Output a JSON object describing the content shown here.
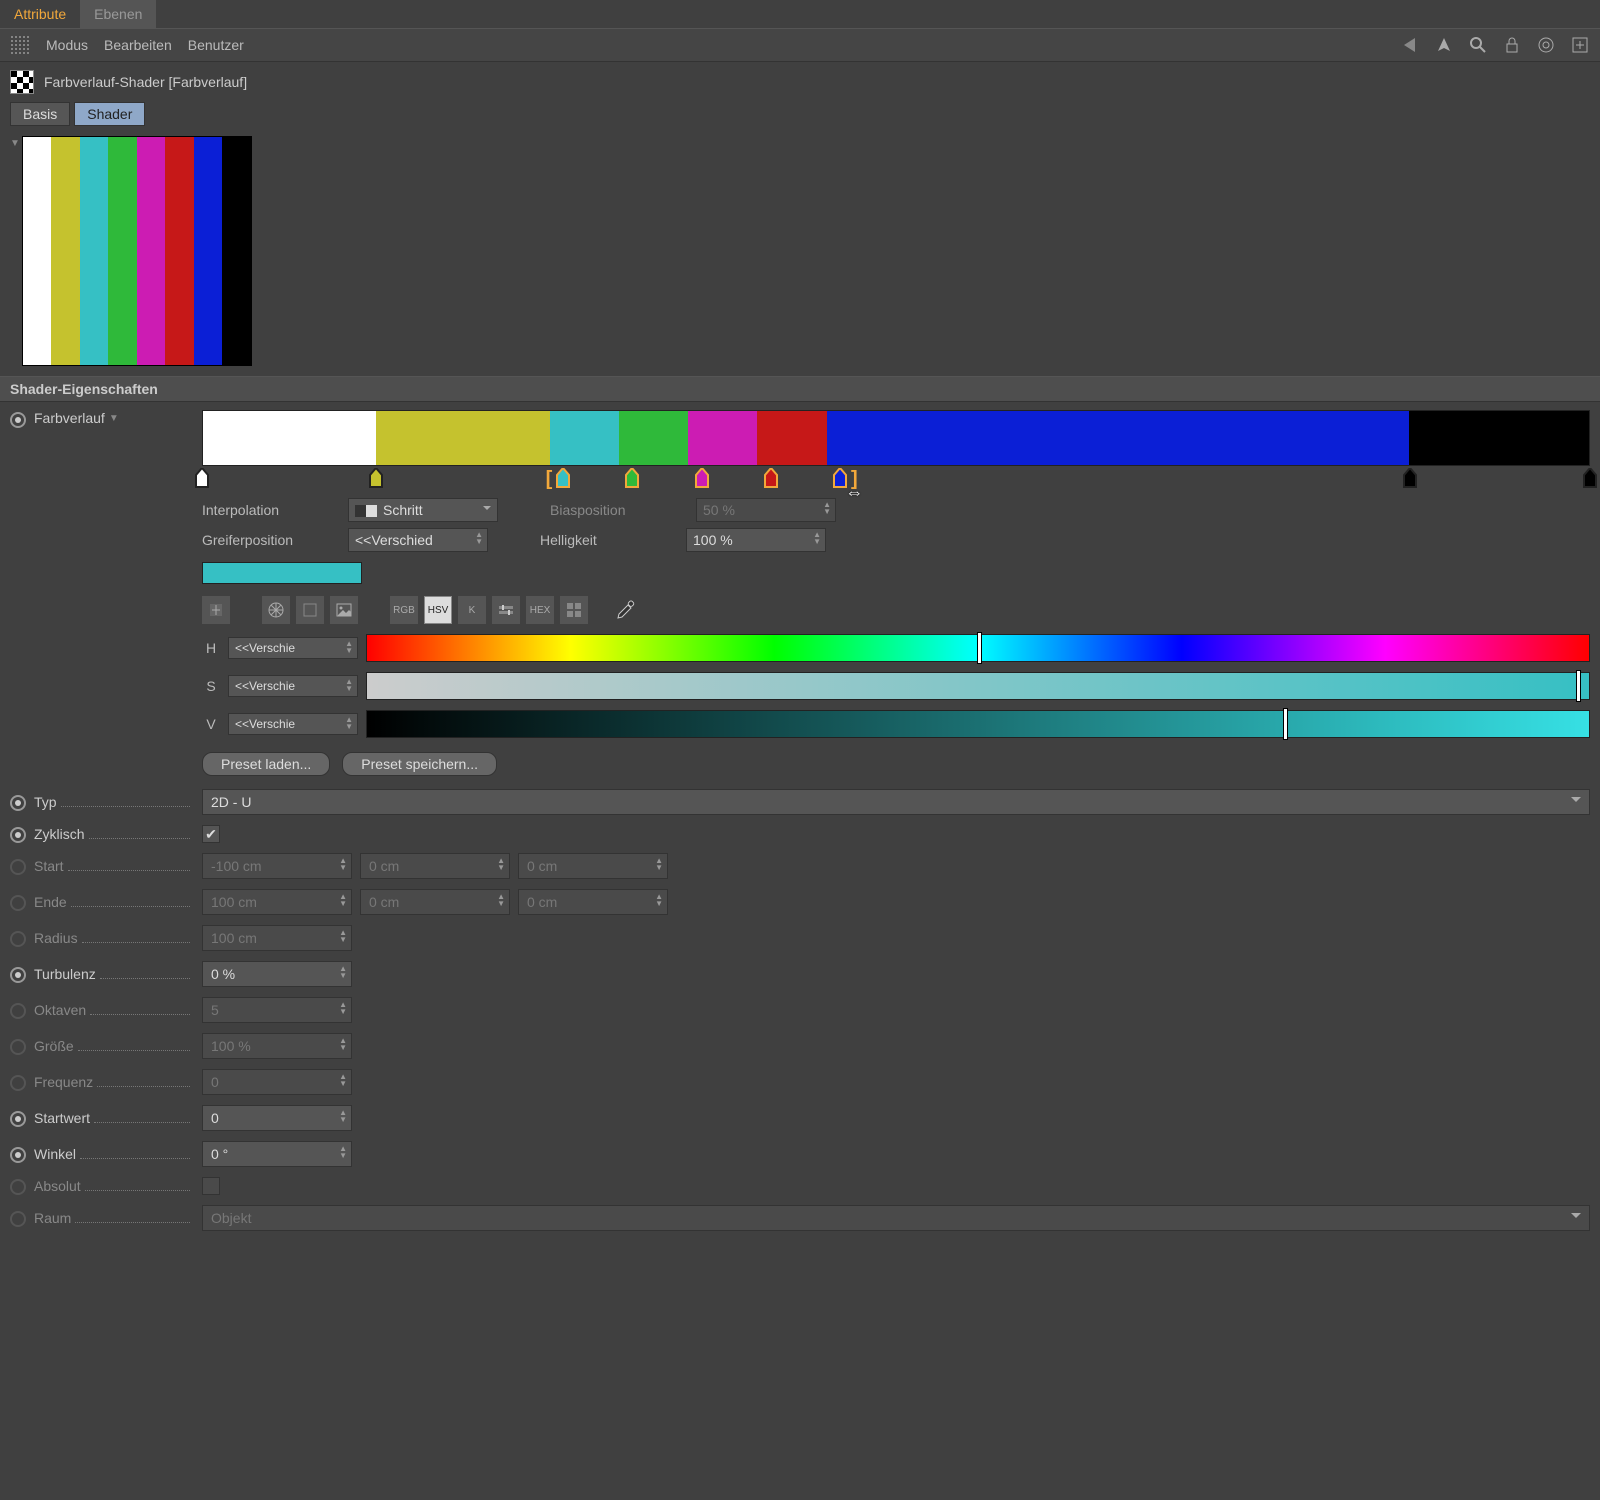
{
  "tabs": {
    "attribute": "Attribute",
    "ebenen": "Ebenen"
  },
  "toolbar": {
    "modus": "Modus",
    "bearbeiten": "Bearbeiten",
    "benutzer": "Benutzer"
  },
  "title": "Farbverlauf-Shader [Farbverlauf]",
  "subtabs": {
    "basis": "Basis",
    "shader": "Shader"
  },
  "preview_colors": [
    "#ffffff",
    "#c5c22e",
    "#36c0c4",
    "#2fb93a",
    "#cc1cb3",
    "#c61818",
    "#0b1fd6",
    "#000000"
  ],
  "section_title": "Shader-Eigenschaften",
  "gradient": {
    "label": "Farbverlauf",
    "stops": [
      {
        "pct": 0,
        "width": 12.5,
        "color": "#ffffff"
      },
      {
        "pct": 12.5,
        "width": 12.5,
        "color": "#c5c22e"
      },
      {
        "pct": 25,
        "width": 5,
        "color": "#36c0c4"
      },
      {
        "pct": 30,
        "width": 5,
        "color": "#2fb93a"
      },
      {
        "pct": 35,
        "width": 5,
        "color": "#cc1cb3"
      },
      {
        "pct": 40,
        "width": 5,
        "color": "#c61818"
      },
      {
        "pct": 45,
        "width": 42,
        "color": "#0b1fd6"
      },
      {
        "pct": 87,
        "width": 13,
        "color": "#000000"
      }
    ],
    "knots": [
      0,
      12.5,
      26,
      31,
      36,
      41,
      46,
      87,
      100
    ],
    "knot_colors": [
      "#ffffff",
      "#c5c22e",
      "#36c0c4",
      "#2fb93a",
      "#cc1cb3",
      "#c61818",
      "#0b1fd6",
      "#000000",
      "#000000"
    ],
    "sel_start": 25,
    "sel_end": 47,
    "cursor": 47
  },
  "interp": {
    "label": "Interpolation",
    "value": "Schritt"
  },
  "greifer": {
    "label": "Greiferposition",
    "value": "<<Verschied"
  },
  "bias": {
    "label": "Biasposition",
    "value": "50 %"
  },
  "hell": {
    "label": "Helligkeit",
    "value": "100 %"
  },
  "modes": {
    "rgb": "RGB",
    "hsv": "HSV",
    "k": "K",
    "hex": "HEX"
  },
  "hsv": {
    "h": {
      "label": "H",
      "value": "<<Verschie",
      "mark": 50
    },
    "s": {
      "label": "S",
      "value": "<<Verschie",
      "mark": 100
    },
    "v": {
      "label": "V",
      "value": "<<Verschie",
      "mark": 75
    }
  },
  "presets": {
    "load": "Preset laden...",
    "save": "Preset speichern..."
  },
  "params": {
    "typ": {
      "label": "Typ",
      "value": "2D - U"
    },
    "zyklisch": {
      "label": "Zyklisch",
      "checked": true
    },
    "start": {
      "label": "Start",
      "v1": "-100 cm",
      "v2": "0 cm",
      "v3": "0 cm"
    },
    "ende": {
      "label": "Ende",
      "v1": "100 cm",
      "v2": "0 cm",
      "v3": "0 cm"
    },
    "radius": {
      "label": "Radius",
      "value": "100 cm"
    },
    "turbulenz": {
      "label": "Turbulenz",
      "value": "0 %"
    },
    "oktaven": {
      "label": "Oktaven",
      "value": "5"
    },
    "groesse": {
      "label": "Größe",
      "value": "100 %"
    },
    "frequenz": {
      "label": "Frequenz",
      "value": "0"
    },
    "startwert": {
      "label": "Startwert",
      "value": "0"
    },
    "winkel": {
      "label": "Winkel",
      "value": "0 °"
    },
    "absolut": {
      "label": "Absolut",
      "checked": false
    },
    "raum": {
      "label": "Raum",
      "value": "Objekt"
    }
  }
}
